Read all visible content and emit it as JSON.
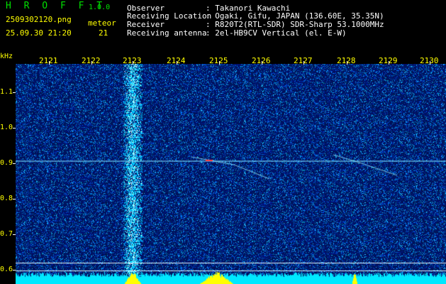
{
  "header": {
    "app_title": "H R O F F T",
    "version": "1.0.0",
    "filename": "2509302120.png",
    "datetime": "25.09.30 21:20",
    "meteor_label": "meteor",
    "meteor_count": "21",
    "observer_label": "Observer",
    "observer_value": ": Takanori Kawachi",
    "location_label": "Receiving Location",
    "location_value": ": Ogaki, Gifu, JAPAN (136.60E, 35.35N)",
    "receiver_label": "Receiver",
    "receiver_value": ": R820T2(RTL-SDR) SDR-Sharp 53.1000MHz",
    "antenna_label": "Receiving antenna",
    "antenna_value": ": 2el-HB9CV Vertical (el. E-W)"
  },
  "axis": {
    "unit": "kHz",
    "x_ticks": [
      "2121",
      "2122",
      "2123",
      "2124",
      "2125",
      "2126",
      "2127",
      "2128",
      "2129",
      "2130"
    ],
    "y_ticks": [
      "1.1",
      "1.0",
      "0.9",
      "0.8",
      "0.7",
      "0.6"
    ]
  },
  "colors": {
    "background": "#000000",
    "label_green": "#00e000",
    "label_yellow": "#ffff00",
    "waterfall_base": "#00105a",
    "signal": "#00ffff",
    "baseline": "#00e8ff",
    "spike": "#ffff00"
  }
}
